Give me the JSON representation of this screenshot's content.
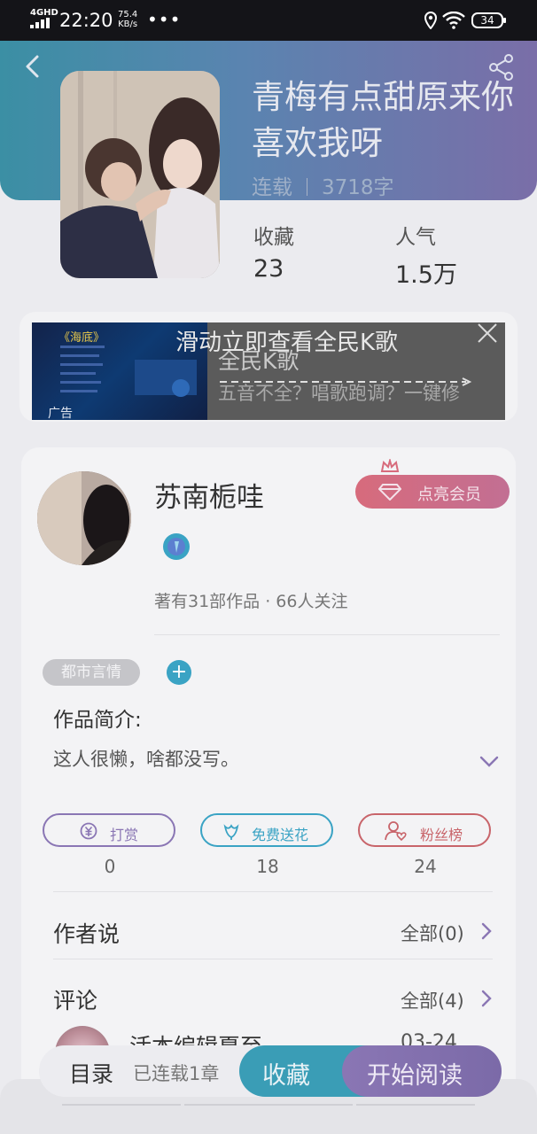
{
  "status_bar": {
    "network": "4GHD",
    "time": "22:20",
    "speed_value": "75.4",
    "speed_unit": "KB/s",
    "dots": "•••",
    "battery": "34"
  },
  "book": {
    "title": "青梅有点甜原来你喜欢我呀",
    "status": "连载",
    "word_count": "3718字",
    "collect_label": "收藏",
    "collect_count": "23",
    "popularity_label": "人气",
    "popularity_count": "1.5万"
  },
  "ad": {
    "slide_hint": "滑动立即查看全民K歌",
    "title": "全民K歌",
    "description": "五音不全？唱歌跑调？一键修",
    "tag": "广告",
    "image_text": "《海底》"
  },
  "author": {
    "name": "苏南栀哇",
    "vip_label": "点亮会员",
    "stats": "著有31部作品 · 66人关注",
    "genre": "都市言情",
    "add_tag": "+",
    "intro_label": "作品简介:",
    "intro_text": "这人很懒，啥都没写。"
  },
  "actions": [
    {
      "label": "打赏",
      "count": "0"
    },
    {
      "label": "免费送花",
      "count": "18"
    },
    {
      "label": "粉丝榜",
      "count": "24"
    }
  ],
  "author_says": {
    "title": "作者说",
    "more": "全部(0)"
  },
  "comments": {
    "title": "评论",
    "more": "全部(4)",
    "first_name": "活本编辑夏至",
    "first_date": "03-24"
  },
  "bottom": {
    "toc": "目录",
    "serial_status": "已连载1章",
    "collect": "收藏",
    "start_reading": "开始阅读"
  },
  "colors": {
    "accent_teal": "#3a9db6",
    "accent_purple": "#8a76b4",
    "vip_pink": "#d76b7c",
    "flower_blue": "#3aa3c4",
    "fans_red": "#c8646a"
  }
}
